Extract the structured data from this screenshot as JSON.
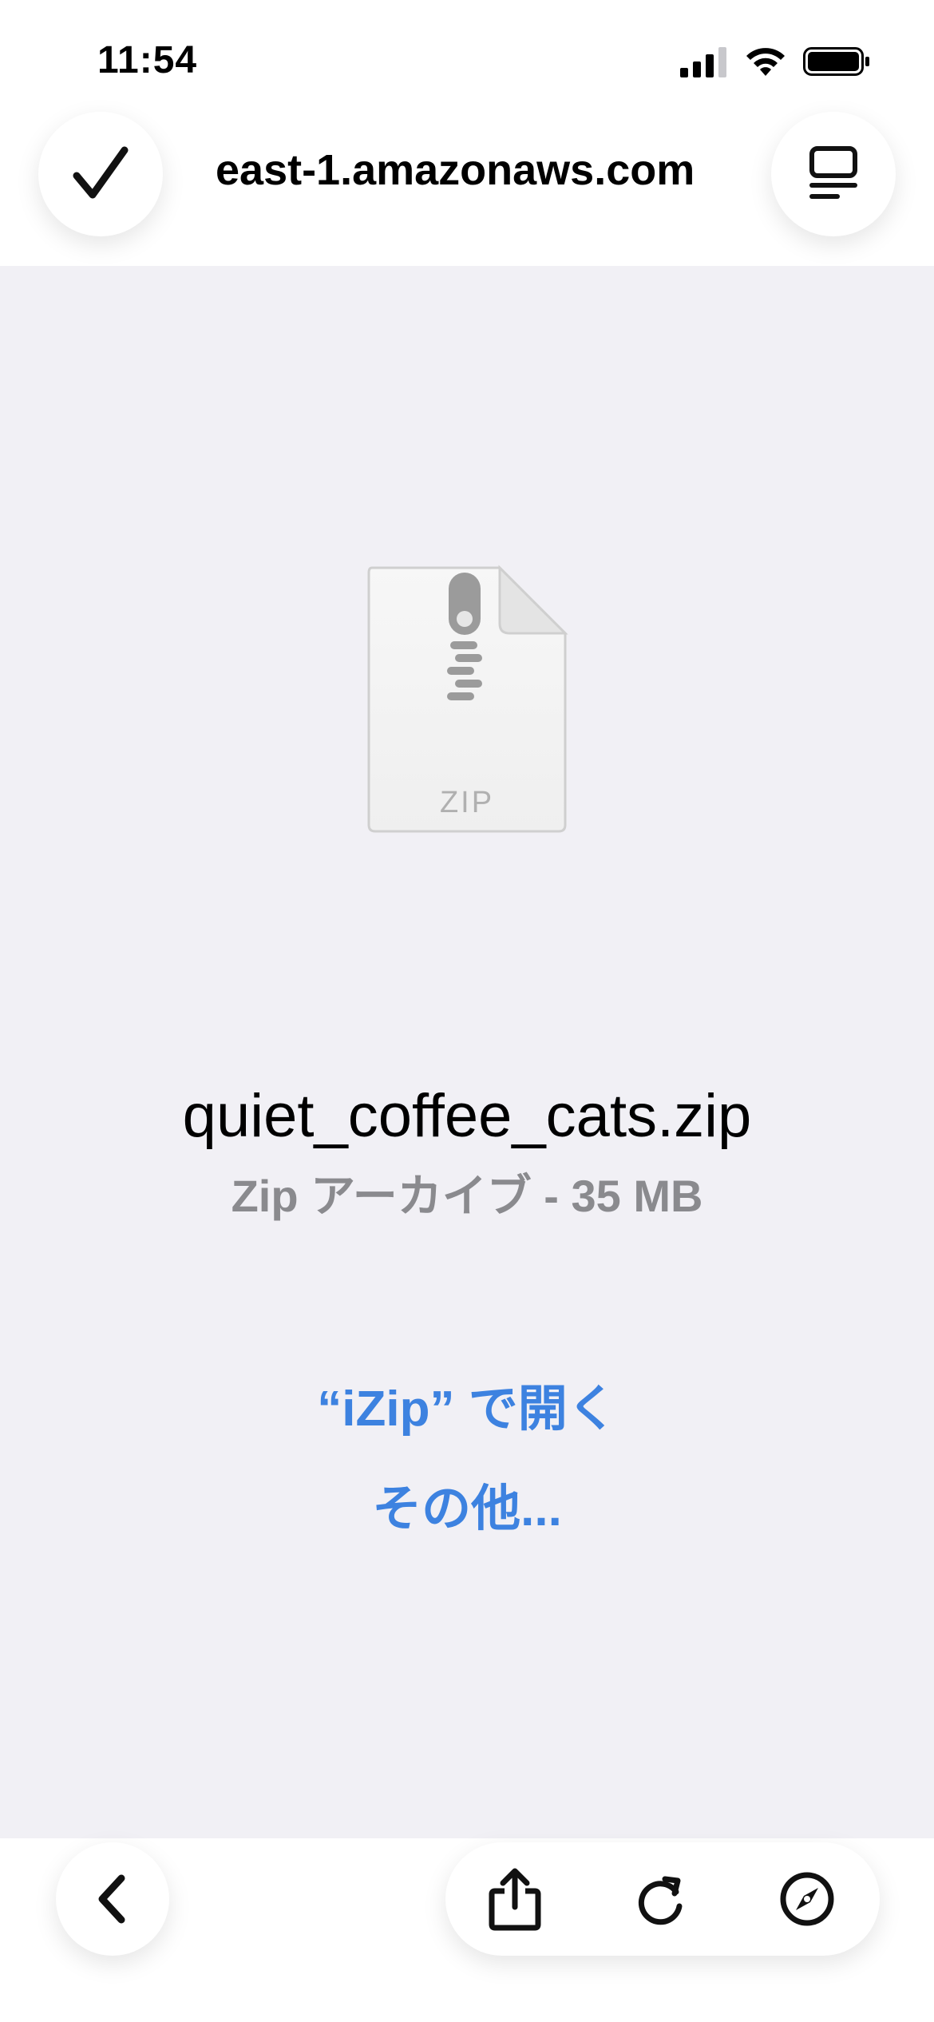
{
  "status_bar": {
    "time": "11:54",
    "icons": [
      "signal-icon",
      "wifi-icon",
      "battery-icon"
    ]
  },
  "url_bar": {
    "url": "east-1.amazonaws.com",
    "done_icon": "checkmark-icon",
    "tabs_icon": "tabs-overview-icon"
  },
  "file": {
    "icon": "zip-file-icon",
    "icon_label": "ZIP",
    "name": "quiet_coffee_cats.zip",
    "meta": "Zip アーカイブ - 35 MB"
  },
  "actions": {
    "open_in": "“iZip” で開く",
    "more": "その他..."
  },
  "toolbar": {
    "back_icon": "chevron-left-icon",
    "share_icon": "share-icon",
    "reload_icon": "reload-icon",
    "compass_icon": "compass-icon"
  },
  "colors": {
    "link": "#3d82e0",
    "background": "#f1f0f5",
    "secondary_text": "#8a8a8e"
  }
}
